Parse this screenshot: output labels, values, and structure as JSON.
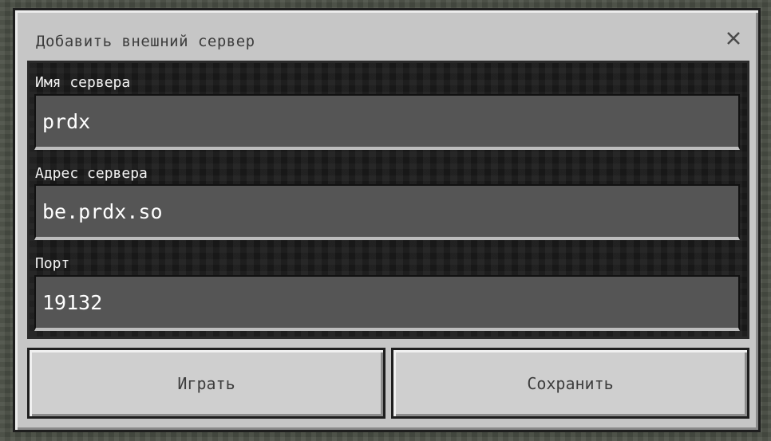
{
  "dialog": {
    "title": "Добавить внешний сервер",
    "close_icon": "close-x-icon"
  },
  "form": {
    "server_name": {
      "label": "Имя сервера",
      "value": "prdx"
    },
    "server_address": {
      "label": "Адрес сервера",
      "value": "be.prdx.so"
    },
    "port": {
      "label": "Порт",
      "value": "19132"
    }
  },
  "buttons": {
    "play_label": "Играть",
    "save_label": "Сохранить"
  }
}
